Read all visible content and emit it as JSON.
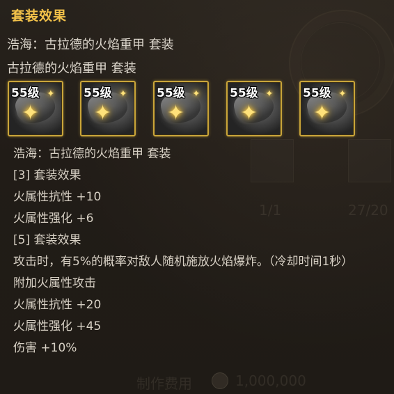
{
  "title": "套装效果",
  "set_line_1": "浩海：古拉德的火焰重甲  套装",
  "set_line_2": "古拉德的火焰重甲  套装",
  "items": [
    {
      "level": "55级"
    },
    {
      "level": "55级"
    },
    {
      "level": "55级"
    },
    {
      "level": "55级"
    },
    {
      "level": "55级"
    }
  ],
  "details": {
    "set_name": "浩海：古拉德的火焰重甲  套装",
    "tier3_header": "[3] 套装效果",
    "tier3_effect1": "火属性抗性 +10",
    "tier3_effect2": "火属性强化 +6",
    "tier5_header": "[5] 套装效果",
    "tier5_effect1": "攻击时，有5%的概率对敌人随机施放火焰爆炸。（冷却时间1秒）",
    "tier5_effect2": "附加火属性攻击",
    "tier5_effect3": "火属性抗性 +20",
    "tier5_effect4": "火属性强化 +45",
    "tier5_effect5": "伤害 +10%"
  },
  "background": {
    "faint_left_num": "1/1",
    "faint_right_num": "27/20",
    "faint_price_label": "制作费用",
    "faint_price": "1,000,000"
  },
  "colors": {
    "title": "#f3c24a",
    "text": "#d7d0c4",
    "icon_border": "#c9a53a",
    "background": "#211c17"
  },
  "icons": {
    "item_icon": "armor-icon",
    "sparkle": "sparkle-icon"
  }
}
